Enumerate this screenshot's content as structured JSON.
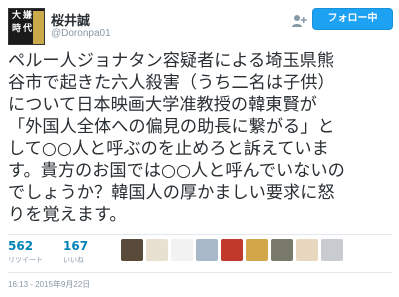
{
  "header": {
    "name": "桜井誠",
    "handle": "@Doronpa01",
    "follow_label": "フォロー中",
    "avatar_text": [
      "大",
      "時",
      "代",
      "嫌"
    ]
  },
  "tweet": {
    "lines": [
      "ペルー人ジョナタン容疑者による埼玉県熊",
      "谷市で起きた六人殺害（うち二名は子供）",
      "について日本映画大学准教授の韓東賢が",
      "「外国人全体への偏見の助長に繋がる」と",
      "して○○人と呼ぶのを止めろと訴えていま",
      "す。貴方のお国では○○人と呼んでいないの",
      "でしょうか？韓国人の厚かましい要求に怒",
      "りを覚えます。"
    ]
  },
  "stats": {
    "retweets": {
      "count": "562",
      "label": "リツイート"
    },
    "likes": {
      "count": "167",
      "label": "いいね"
    }
  },
  "likers": [
    {
      "name": "liker-1",
      "color": "#5a4a3a"
    },
    {
      "name": "liker-2",
      "color": "#e8e0d0"
    },
    {
      "name": "liker-3",
      "color": "#f2f2f2"
    },
    {
      "name": "liker-4",
      "color": "#a8b8c8"
    },
    {
      "name": "liker-5",
      "color": "#c0392b"
    },
    {
      "name": "liker-6",
      "color": "#d4a64a"
    },
    {
      "name": "liker-7",
      "color": "#7a7a6a"
    },
    {
      "name": "liker-8",
      "color": "#e8d8c0"
    },
    {
      "name": "liker-9",
      "color": "#c8ccd0"
    }
  ],
  "timestamp": "16:13 - 2015年9月22日",
  "colors": {
    "accent": "#1da1f2",
    "link": "#0084b4",
    "muted": "#8899a6"
  }
}
